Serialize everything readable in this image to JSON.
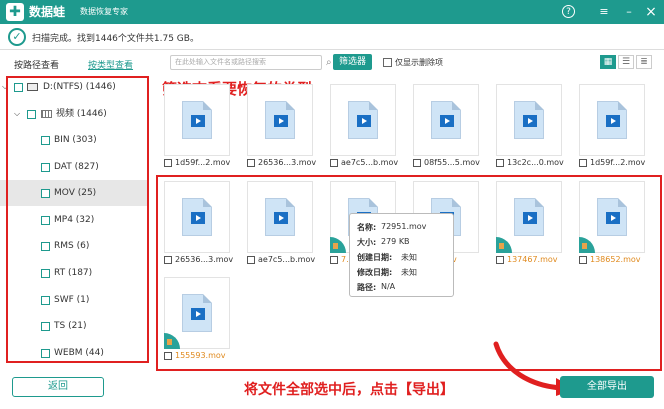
{
  "app": {
    "logo": "✚",
    "name": "数据蛙",
    "subtitle": "数据恢复专家"
  },
  "titlebar": {
    "help_icon": "?",
    "menu_icon": "≡",
    "minimize_icon": "–",
    "close_icon": "×"
  },
  "status": {
    "text": "扫描完成。找到1446个文件共1.75 GB。"
  },
  "left_tabs": {
    "by_path": "按路径查看",
    "by_type": "按类型查看",
    "active": "by_type"
  },
  "tree": {
    "drive": "D:(NTFS) (1446)",
    "folder": "视频 (1446)",
    "types": [
      {
        "label": "BIN (303)"
      },
      {
        "label": "DAT (827)"
      },
      {
        "label": "MOV (25)",
        "selected": true
      },
      {
        "label": "MP4 (32)"
      },
      {
        "label": "RMS (6)"
      },
      {
        "label": "RT (187)"
      },
      {
        "label": "SWF (1)"
      },
      {
        "label": "TS (21)"
      },
      {
        "label": "WEBM (44)"
      }
    ]
  },
  "annotations": {
    "top": "筛选查看要恢复的类型",
    "bottom": "将文件全部选中后，点击【导出】"
  },
  "toolbar": {
    "search_placeholder": "在此处输入文件名或路径搜索",
    "filter": "筛选器",
    "only_deleted": "仅显示删除项"
  },
  "files_row1": [
    "1d59f...2.mov",
    "26536...3.mov",
    "ae7c5...b.mov",
    "08f55...5.mov",
    "13c2c...0.mov",
    "1d59f...2.mov"
  ],
  "files_row2": [
    "26536...3.mov",
    "ae7c5...b.mov",
    "7...",
    "...2.mov",
    "137467.mov",
    "138652.mov"
  ],
  "files_row3": [
    "155593.mov"
  ],
  "tooltip": {
    "name_k": "名称:",
    "name_v": "72951.mov",
    "size_k": "大小:",
    "size_v": "279 KB",
    "created_k": "创建日期:",
    "created_v": "未知",
    "modified_k": "修改日期:",
    "modified_v": "未知",
    "path_k": "路径:",
    "path_v": "N/A"
  },
  "buttons": {
    "back": "返回",
    "export_all": "全部导出"
  },
  "colors": {
    "accent": "#1e9a8e",
    "annotation": "#e02020",
    "recovered_name": "#e08a1e"
  }
}
